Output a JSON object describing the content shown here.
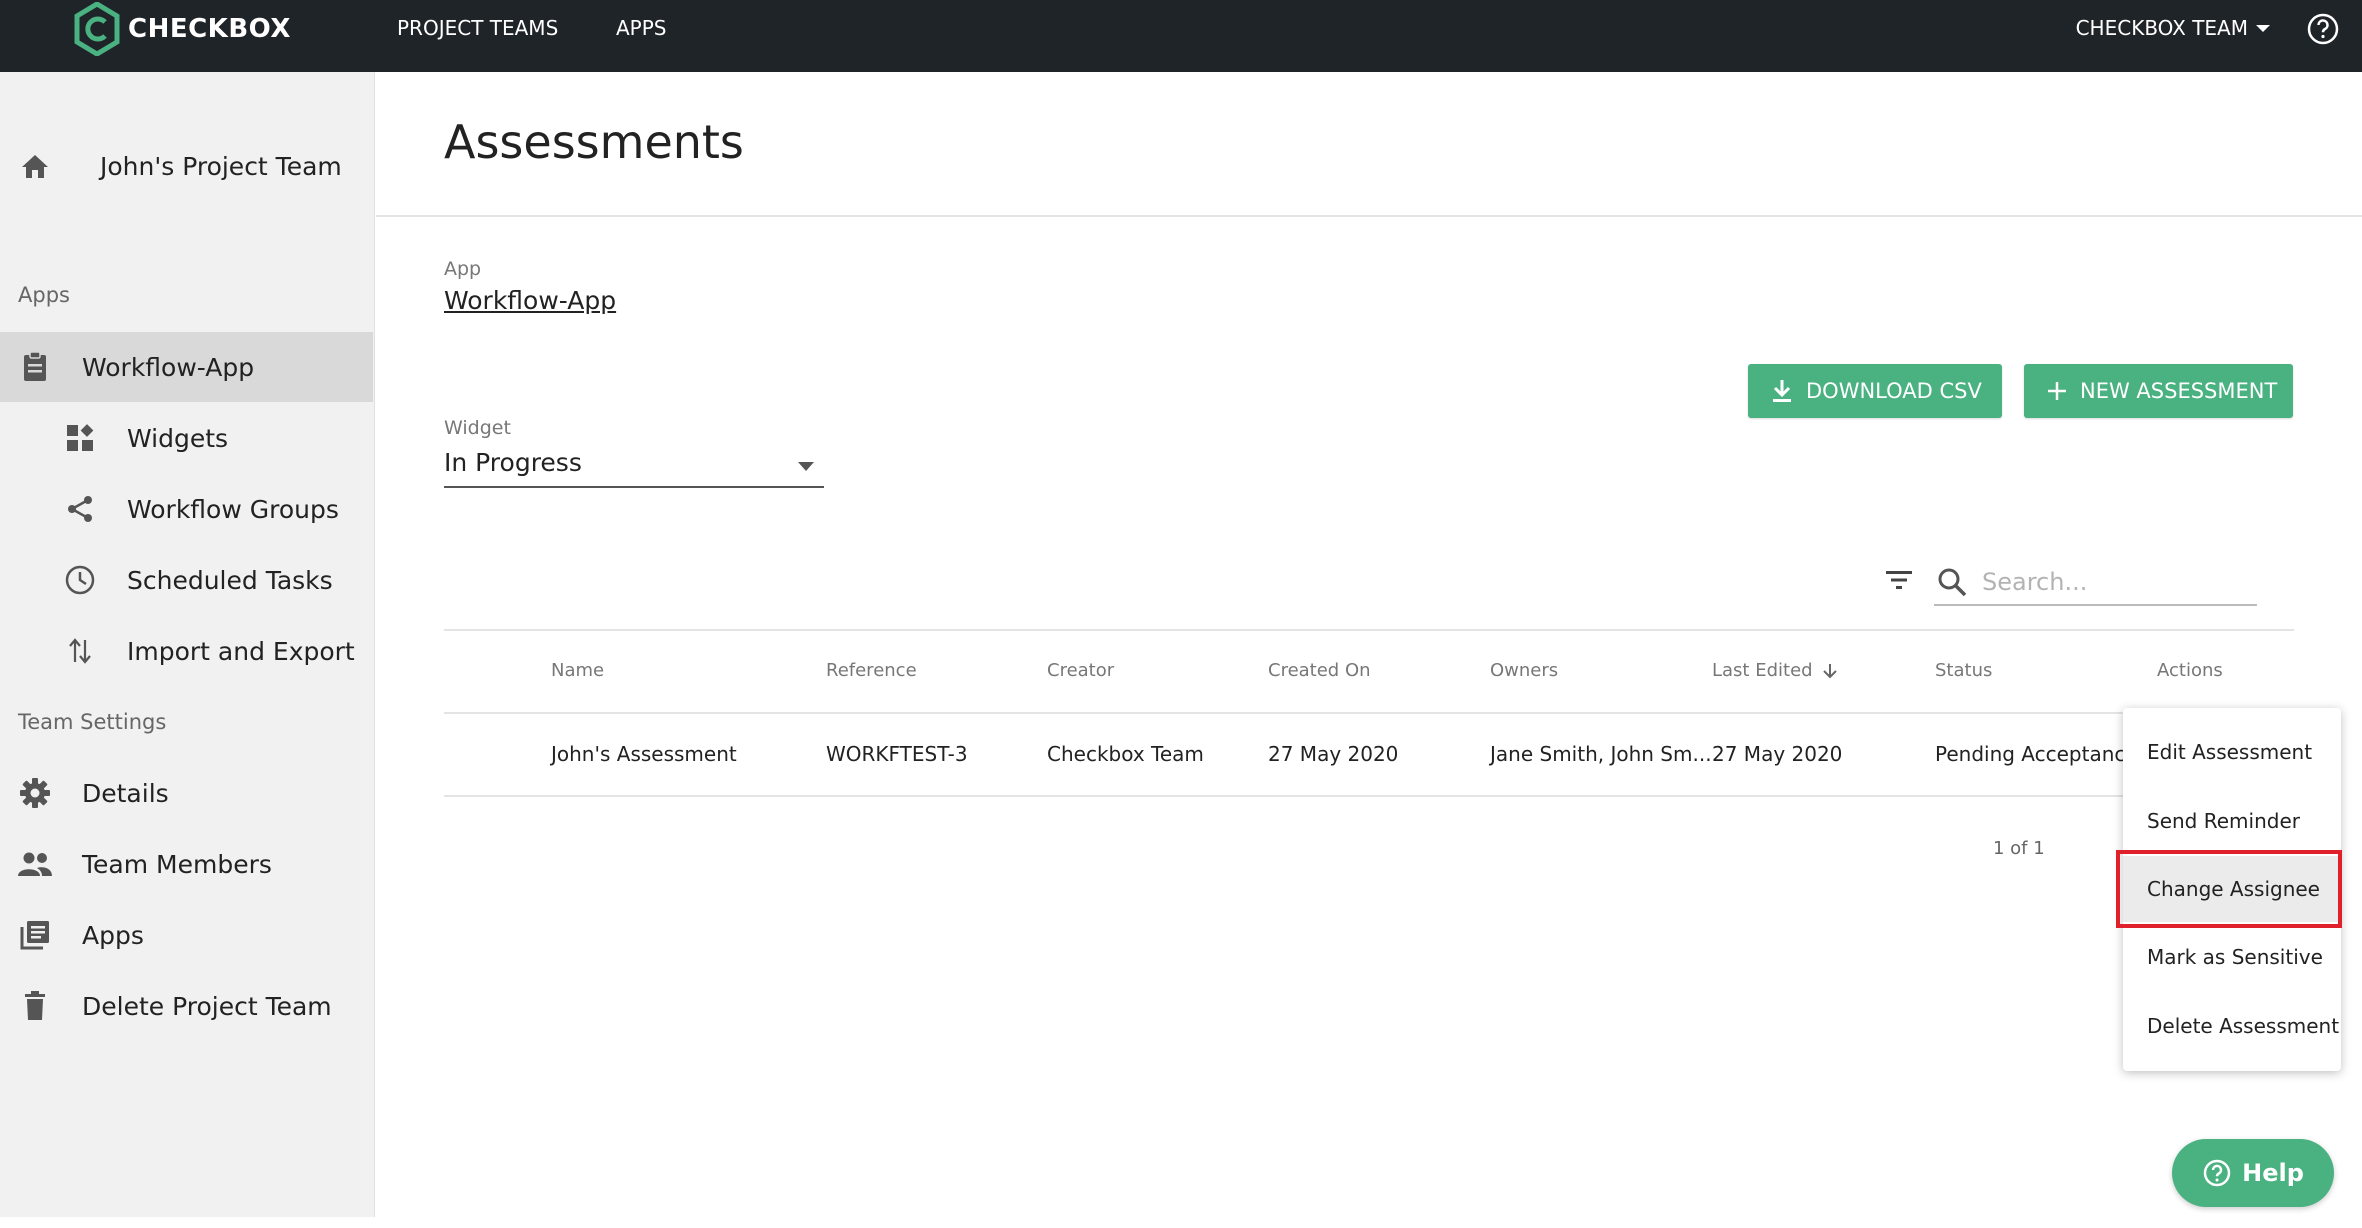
{
  "topbar": {
    "logo_text": "CHECKBOX",
    "nav": [
      "PROJECT TEAMS",
      "APPS"
    ],
    "team_menu": "CHECKBOX TEAM",
    "help_icon": "question-circle-icon"
  },
  "sidebar": {
    "project_team": "John's Project Team",
    "apps_heading": "Apps",
    "app_items": [
      {
        "label": "Workflow-App",
        "icon": "clipboard-icon",
        "active": true
      },
      {
        "label": "Widgets",
        "icon": "widgets-icon"
      },
      {
        "label": "Workflow Groups",
        "icon": "share-icon"
      },
      {
        "label": "Scheduled Tasks",
        "icon": "clock-icon"
      },
      {
        "label": "Import and Export",
        "icon": "import-export-icon"
      }
    ],
    "team_settings_heading": "Team Settings",
    "settings_items": [
      {
        "label": "Details",
        "icon": "gear-icon"
      },
      {
        "label": "Team Members",
        "icon": "people-icon"
      },
      {
        "label": "Apps",
        "icon": "library-icon"
      },
      {
        "label": "Delete Project Team",
        "icon": "trash-icon"
      }
    ]
  },
  "main": {
    "title": "Assessments",
    "app_caption": "App",
    "app_value": "Workflow-App",
    "widget_caption": "Widget",
    "widget_value": "In Progress",
    "download_label": "DOWNLOAD CSV",
    "new_label": "NEW ASSESSMENT",
    "search_placeholder": "Search..."
  },
  "table": {
    "headers": [
      "Name",
      "Reference",
      "Creator",
      "Created On",
      "Owners",
      "Last Edited",
      "Status",
      "Actions"
    ],
    "rows": [
      {
        "name": "John's Assessment",
        "reference": "WORKFTEST-3",
        "creator": "Checkbox Team",
        "created_on": "27 May 2020",
        "owners": "Jane Smith, John Sm...",
        "last_edited": "27 May 2020",
        "status": "Pending Acceptance"
      }
    ],
    "pagination": "1 of 1"
  },
  "actions_menu": {
    "items": [
      "Edit Assessment",
      "Send Reminder",
      "Change Assignee",
      "Mark as Sensitive",
      "Delete Assessment"
    ],
    "highlighted": "Change Assignee"
  },
  "help_button": "Help",
  "colors": {
    "topbar": "#1f2429",
    "accent_green": "#4ab181",
    "sidebar_bg": "#f1f1f1",
    "highlight_red": "#e0202a"
  }
}
